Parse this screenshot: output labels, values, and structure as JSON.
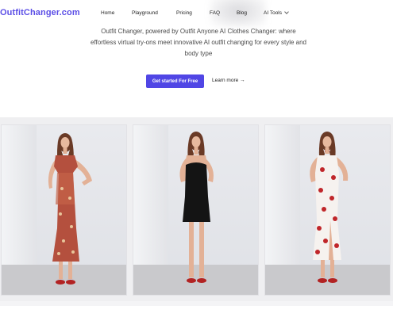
{
  "header": {
    "brand": "OutfitChanger.com",
    "nav": [
      {
        "label": "Home"
      },
      {
        "label": "Playground"
      },
      {
        "label": "Pricing"
      },
      {
        "label": "FAQ"
      },
      {
        "label": "Blog"
      },
      {
        "label": "AI Tools"
      }
    ]
  },
  "hero": {
    "tagline_line1": "Outfit Changer, powered by Outfit Anyone AI Clothes Changer: where",
    "tagline_line2": "effortless virtual try-ons meet innovative AI outfit changing for every style and",
    "tagline_line3": "body type",
    "primary_cta": "Get started For Free",
    "secondary_cta": "Learn more →"
  },
  "gallery": {
    "images": [
      {
        "name": "model-floral-red-dress"
      },
      {
        "name": "model-black-strapless-dress"
      },
      {
        "name": "model-white-rose-print-dress"
      }
    ]
  },
  "colors": {
    "accent": "#5046e5",
    "brand_text": "#5b4ee6"
  }
}
